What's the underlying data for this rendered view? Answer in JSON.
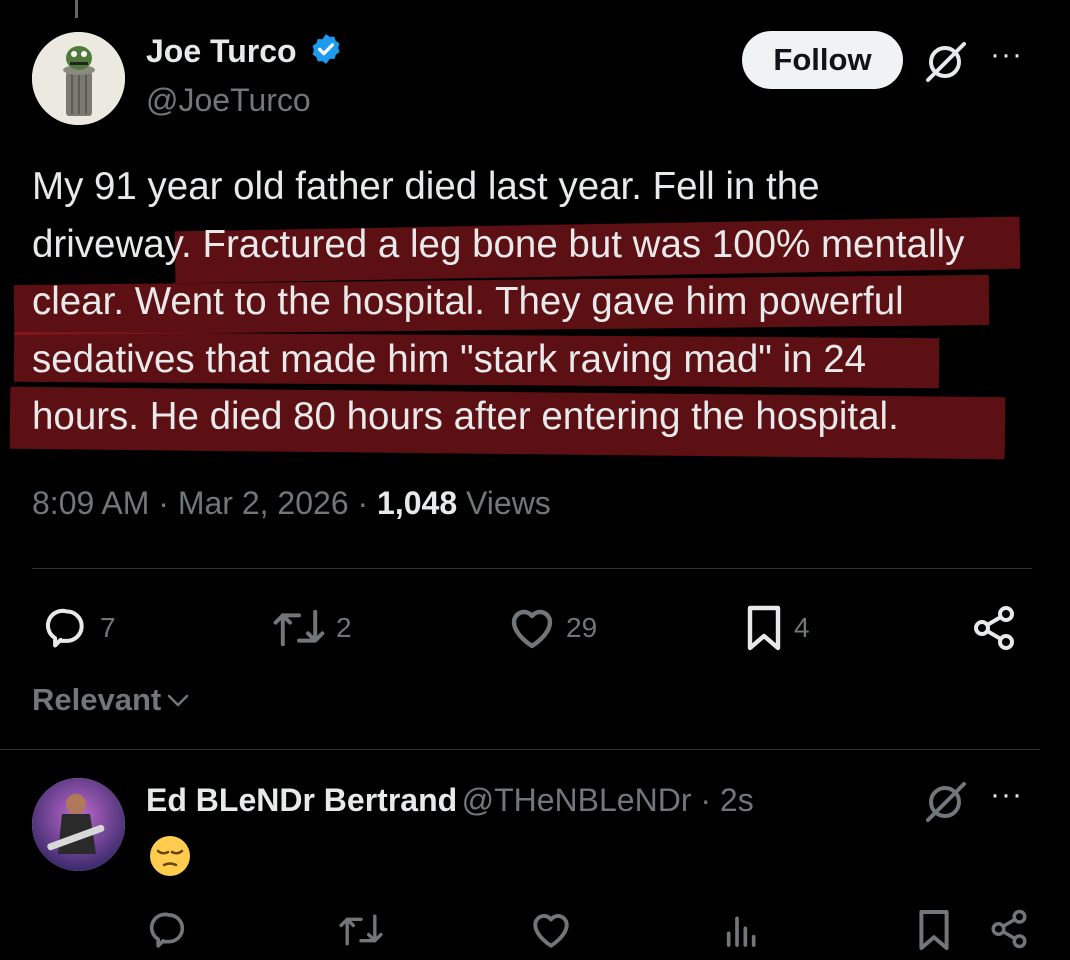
{
  "tweet": {
    "author_name": "Joe Turco",
    "author_handle": "@JoeTurco",
    "follow_label": "Follow",
    "more_label": "···",
    "text": "My 91 year old father died last year.  Fell in the\ndriveway.  Fractured a leg bone but was 100% mentally\nclear.  Went to the hospital.  They gave him powerful\nsedatives that  made him \"stark raving mad\" in 24\nhours.  He died 80 hours after entering the hospital.",
    "time": "8:09 AM",
    "date": "Mar 2, 2026",
    "views_count": "1,048",
    "views_label": "Views",
    "sep": " · ",
    "actions": {
      "replies": "7",
      "reposts": "2",
      "likes": "29",
      "bookmarks": "4"
    }
  },
  "sort": {
    "label": "Relevant"
  },
  "reply": {
    "author_name": "Ed BLeNDr Bertrand",
    "author_handle": "@THeNBLeNDr",
    "time": "2s",
    "sep": " · ",
    "more_label": "···",
    "content_emoji": "pensive-face"
  },
  "colors": {
    "background": "#000000",
    "text": "#e7e9ea",
    "secondary": "#71767b",
    "verified": "#1d9bf0",
    "highlight": "#961a1e"
  },
  "icons": [
    "verified-badge-icon",
    "grok-icon",
    "more-icon",
    "reply-icon",
    "repost-icon",
    "like-icon",
    "bookmark-icon",
    "share-icon",
    "views-icon",
    "chevron-down-icon"
  ]
}
